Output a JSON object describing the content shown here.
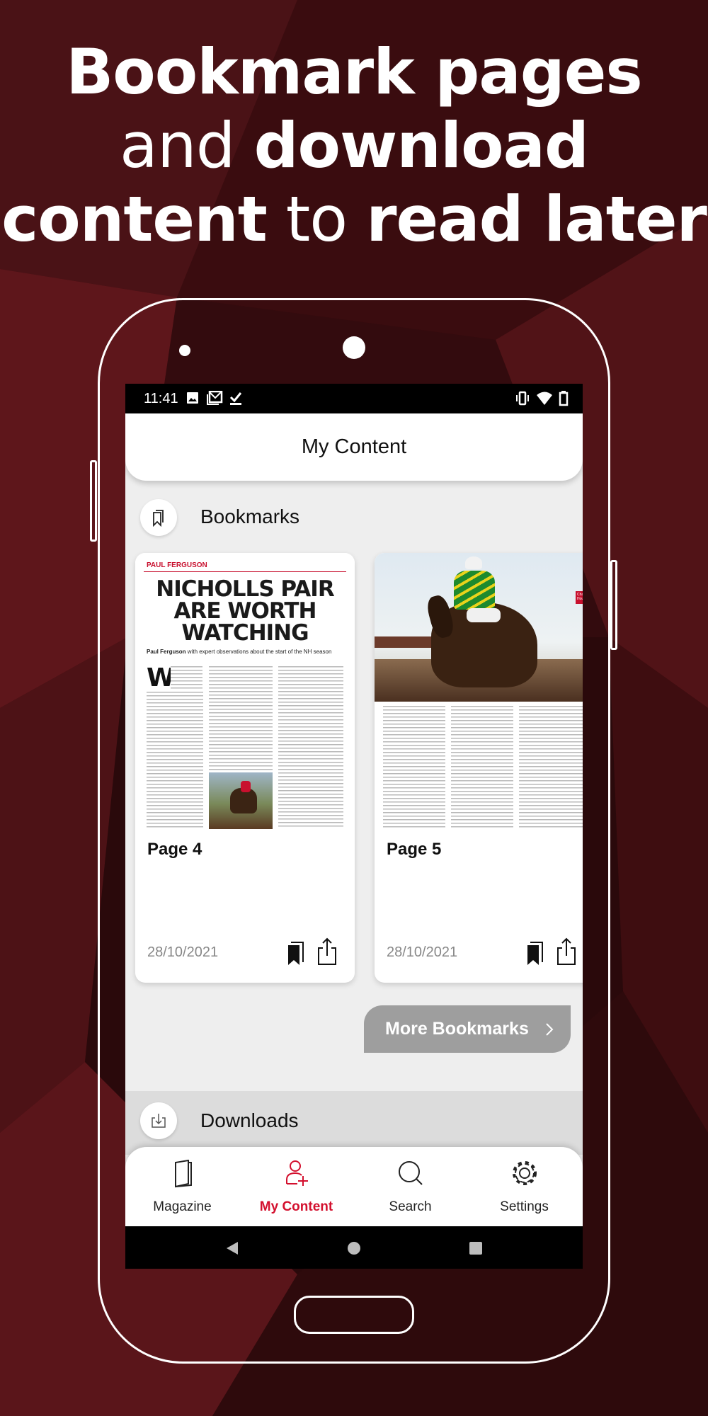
{
  "promo": {
    "line1_bold": "Bookmark pages",
    "line2_light": "and ",
    "line2_bold": "download",
    "line3_bold_a": "content",
    "line3_light": " to ",
    "line3_bold_b": "read later"
  },
  "status_bar": {
    "time": "11:41",
    "left_icons": [
      "image-icon",
      "gmail-icon",
      "download-done-icon"
    ],
    "right_icons": [
      "vibrate-icon",
      "wifi-icon",
      "battery-icon"
    ]
  },
  "header": {
    "title": "My Content"
  },
  "bookmarks": {
    "title": "Bookmarks",
    "icon": "bookmarks-icon",
    "cards": [
      {
        "label": "Page 4",
        "date": "28/10/2021",
        "thumb": {
          "byline": "PAUL FERGUSON",
          "headline": "NICHOLLS PAIR ARE WORTH WATCHING",
          "standfirst_bold": "Paul Ferguson",
          "standfirst": " with expert observations about the start of the NH season"
        }
      },
      {
        "label": "Page 5",
        "date": "28/10/2021",
        "thumb": {
          "tag": "Chantry House"
        }
      }
    ],
    "more_label": "More Bookmarks"
  },
  "downloads": {
    "title": "Downloads",
    "icon": "download-icon"
  },
  "bottom_nav": {
    "active_color": "#d3102e",
    "items": [
      {
        "label": "Magazine",
        "icon": "magazine-icon"
      },
      {
        "label": "My Content",
        "icon": "user-add-icon",
        "active": true
      },
      {
        "label": "Search",
        "icon": "search-icon"
      },
      {
        "label": "Settings",
        "icon": "gear-icon"
      }
    ]
  }
}
